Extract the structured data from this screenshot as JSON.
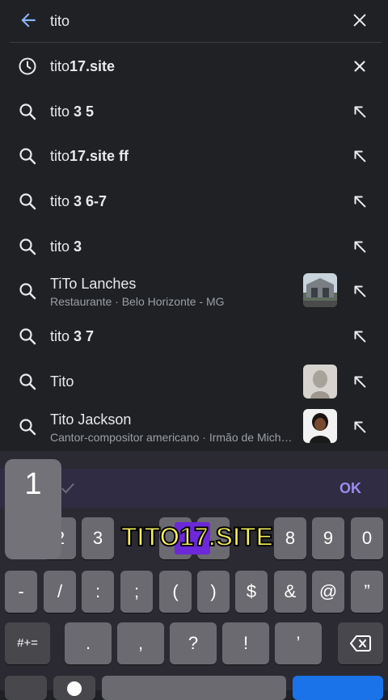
{
  "search": {
    "query": "tito"
  },
  "suggestions": [
    {
      "prefix": "tito",
      "bold": "17.site",
      "type": "history"
    },
    {
      "prefix": "tito ",
      "bold": "3 5",
      "type": "search"
    },
    {
      "prefix": "tito",
      "bold": "17.site ff",
      "type": "search"
    },
    {
      "prefix": "tito ",
      "bold": "3 6-7",
      "type": "search"
    },
    {
      "prefix": "tito ",
      "bold": "3",
      "type": "search"
    },
    {
      "prefix": "TiTo Lanches",
      "bold": "",
      "subtitle": "Restaurante · Belo Horizonte - MG",
      "type": "place"
    },
    {
      "prefix": "tito ",
      "bold": "3 7",
      "type": "search"
    },
    {
      "prefix": "Tito",
      "bold": "",
      "type": "entity"
    },
    {
      "prefix": "Tito Jackson",
      "bold": "",
      "subtitle": "Cantor-compositor americano · Irmão de Mich…",
      "type": "entity"
    }
  ],
  "keyboard": {
    "ok_label": "OK",
    "popup_key": "1",
    "row1": [
      "2",
      "3",
      "",
      "",
      "8",
      "9",
      "0"
    ],
    "row2": [
      "-",
      "/",
      ":",
      ";",
      "(",
      ")",
      "$",
      "&",
      "@",
      "”"
    ],
    "row3": [
      ".",
      ",",
      "?",
      "!",
      "’"
    ],
    "symbols_label": "#+="
  },
  "overlay": {
    "text": "TITO17.SITE"
  }
}
